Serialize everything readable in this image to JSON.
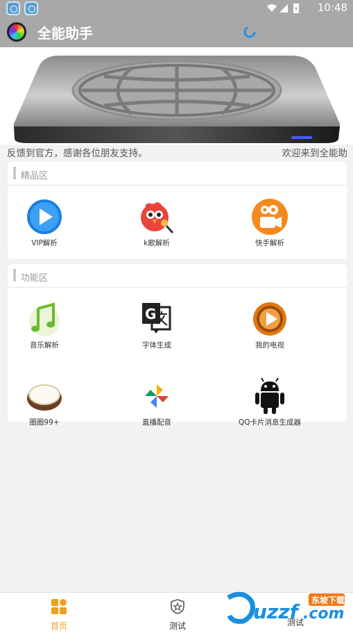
{
  "status_bar": {
    "time": "10:48",
    "app_icons": [
      "rox-app-icon",
      "rox-app-icon"
    ]
  },
  "app_bar": {
    "title": "全能助手",
    "logo_icon": "color-circle-logo-icon",
    "loading_icon": "loading-spinner-icon"
  },
  "banner": {
    "image": "metal-globe-pad-image"
  },
  "scroll_text": {
    "left": "反馈到官方，感谢各位朋友支持。",
    "right": "欢迎来到全能助"
  },
  "sections": [
    {
      "title": "精品区",
      "items": [
        {
          "label": "VIP解析",
          "icon": "play-button-icon"
        },
        {
          "label": "k歌解析",
          "icon": "parrot-mic-icon"
        },
        {
          "label": "快手解析",
          "icon": "video-camera-icon"
        }
      ]
    },
    {
      "title": "功能区",
      "items": [
        {
          "label": "音乐解析",
          "icon": "music-note-icon"
        },
        {
          "label": "字体生成",
          "icon": "translate-icon"
        },
        {
          "label": "我的电视",
          "icon": "tv-play-icon"
        },
        {
          "label": "圈圈99+",
          "icon": "coconut-icon"
        },
        {
          "label": "直播配音",
          "icon": "pinwheel-icon"
        },
        {
          "label": "QQ卡片消息生成器",
          "icon": "android-icon"
        }
      ]
    }
  ],
  "bottom_nav": [
    {
      "label": "首页",
      "icon": "home-grid-icon",
      "active": true
    },
    {
      "label": "测试",
      "icon": "shield-star-icon",
      "active": false
    },
    {
      "label": "测试",
      "icon": "",
      "active": false
    }
  ],
  "colors": {
    "accent": "#f0a020",
    "status_bar": "#a8a8aa",
    "app_bar": "#a8a8aa",
    "page_bg": "#f2f2f4"
  }
}
